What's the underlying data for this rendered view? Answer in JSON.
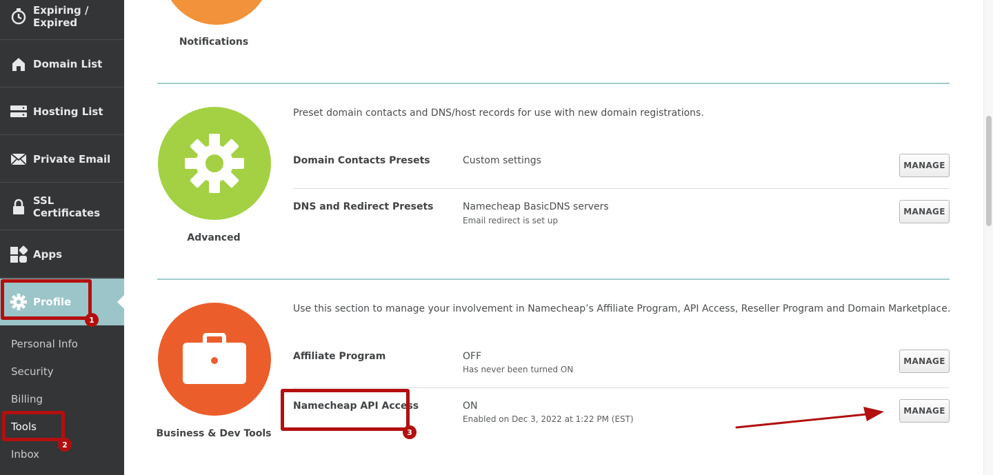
{
  "sidebar": {
    "items": [
      {
        "label": "Expiring / Expired",
        "icon": "timer-icon"
      },
      {
        "label": "Domain List",
        "icon": "home-icon"
      },
      {
        "label": "Hosting List",
        "icon": "server-icon"
      },
      {
        "label": "Private Email",
        "icon": "envelope-icon"
      },
      {
        "label": "SSL Certificates",
        "icon": "lock-icon"
      },
      {
        "label": "Apps",
        "icon": "apps-grid-icon"
      },
      {
        "label": "Profile",
        "icon": "gear-icon"
      }
    ],
    "profile_sub": [
      "Personal Info",
      "Security",
      "Billing",
      "Tools",
      "Inbox"
    ]
  },
  "annotations": {
    "badge1": "1",
    "badge2": "2",
    "badge3": "3"
  },
  "sections": {
    "notifications": {
      "label": "Notifications",
      "color": "#f2923a"
    },
    "advanced": {
      "label": "Advanced",
      "color": "#a3d143",
      "description": "Preset domain contacts and DNS/host records for use with new domain registrations.",
      "rows": [
        {
          "title": "Domain Contacts Presets",
          "value": "Custom settings",
          "sub": "",
          "button": "MANAGE"
        },
        {
          "title": "DNS and Redirect Presets",
          "value": "Namecheap BasicDNS servers",
          "sub": "Email redirect is set up",
          "button": "MANAGE"
        }
      ]
    },
    "business": {
      "label": "Business & Dev Tools",
      "color": "#eb5e2b",
      "description": "Use this section to manage your involvement in Namecheap’s Affiliate Program, API Access, Reseller Program and Domain Marketplace.",
      "rows": [
        {
          "title": "Affiliate Program",
          "value": "OFF",
          "sub": "Has never been turned ON",
          "button": "MANAGE"
        },
        {
          "title": "Namecheap API Access",
          "value": "ON",
          "sub": "Enabled on Dec 3, 2022 at 1:22 PM (EST)",
          "button": "MANAGE"
        }
      ]
    }
  },
  "colors": {
    "sidebar_bg": "#333537",
    "active_bg": "#9bc5c8",
    "annotation_red": "#b30f0f",
    "divider": "#9fcbcc"
  }
}
